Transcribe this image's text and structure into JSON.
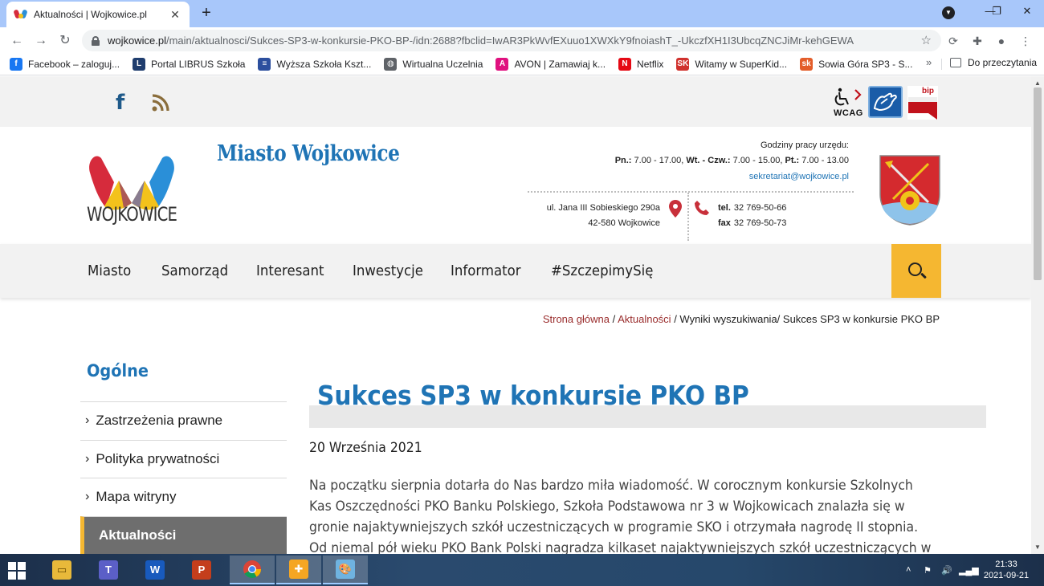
{
  "browser": {
    "tab_title": "Aktualności | Wojkowice.pl",
    "tab_close": "✕",
    "new_tab": "+",
    "url_domain": "wojkowice.pl",
    "url_path": "/main/aktualnosci/Sukces-SP3-w-konkursie-PKO-BP-/idn:2688?fbclid=IwAR3PkWvfEXuuo1XWXkY9fnoiashT_-UkczfXH1I3UbcqZNCJiMr-kehGEWA",
    "bookmarks": [
      {
        "label": "Facebook – zaloguj...",
        "icon": "facebook-icon",
        "color": "#1877f2",
        "glyph": "f"
      },
      {
        "label": "Portal LIBRUS Szkoła",
        "icon": "librus-icon",
        "color": "#1f3d6e",
        "glyph": "L"
      },
      {
        "label": "Wyższa Szkoła Kszt...",
        "icon": "wsk-icon",
        "color": "#2c4f9e",
        "glyph": "≡"
      },
      {
        "label": "Wirtualna Uczelnia",
        "icon": "globe-icon",
        "color": "#5f6368",
        "glyph": "◍"
      },
      {
        "label": "AVON | Zamawiaj k...",
        "icon": "avon-icon",
        "color": "#e0117f",
        "glyph": "A"
      },
      {
        "label": "Netflix",
        "icon": "netflix-icon",
        "color": "#e50914",
        "glyph": "N"
      },
      {
        "label": "Witamy w SuperKid...",
        "icon": "superkid-icon",
        "color": "#d0312d",
        "glyph": "SK"
      },
      {
        "label": "Sowia Góra SP3 - S...",
        "icon": "sko-icon",
        "color": "#e35d2a",
        "glyph": "sk"
      }
    ],
    "bookmarks_more": "»",
    "reading_list": "Do przeczytania"
  },
  "site": {
    "title": "Miasto Wojkowice",
    "logo_text": "WOJKOWICE",
    "wcag_label": "WCAG",
    "bip_label": "bip",
    "hours_label": "Godziny pracy urzędu:",
    "hours": {
      "mon_label": "Pn.:",
      "mon": "7.00 - 17.00,",
      "wed_label": "Wt. - Czw.:",
      "wed": "7.00 - 15.00,",
      "fri_label": "Pt.:",
      "fri": "7.00 - 13.00"
    },
    "email": "sekretariat@wojkowice.pl",
    "address_line1": "ul. Jana III Sobieskiego 290a",
    "address_line2": "42-580 Wojkowice",
    "tel_label": "tel.",
    "tel": "32 769-50-66",
    "fax_label": "fax",
    "fax": "32 769-50-73"
  },
  "nav": [
    "Miasto",
    "Samorząd",
    "Interesant",
    "Inwestycje",
    "Informator",
    "#SzczepimySię"
  ],
  "breadcrumb": {
    "home": "Strona główna",
    "sep": " / ",
    "news": "Aktualności",
    "results": "Wyniki wyszukiwania",
    "sep2": "/ ",
    "current": "Sukces SP3 w konkursie PKO BP"
  },
  "sidebar": {
    "title": "Ogólne",
    "items": [
      "Zastrzeżenia prawne",
      "Polityka prywatności",
      "Mapa witryny",
      "Aktualności"
    ]
  },
  "article": {
    "title": "Sukces SP3 w konkursie PKO BP",
    "date": "20 Września 2021",
    "lines": [
      "Na początku sierpnia dotarła do Nas bardzo miła wiadomość. W corocznym konkursie Szkolnych",
      "Kas Oszczędności PKO Banku Polskiego, Szkoła Podstawowa nr 3 w Wojkowicach znalazła się w",
      "gronie najaktywniejszych szkół uczestniczących w programie SKO i otrzymała nagrodę II stopnia.",
      "Od niemal pół wieku PKO Bank Polski nagradza kilkaset najaktywniejszych szkół uczestniczących w"
    ]
  },
  "taskbar": {
    "time": "21:33",
    "date": "2021-09-21"
  },
  "colors": {
    "brand_blue": "#1f74b5",
    "accent_yellow": "#f5b731",
    "breadcrumb_link": "#9a2d2d"
  }
}
